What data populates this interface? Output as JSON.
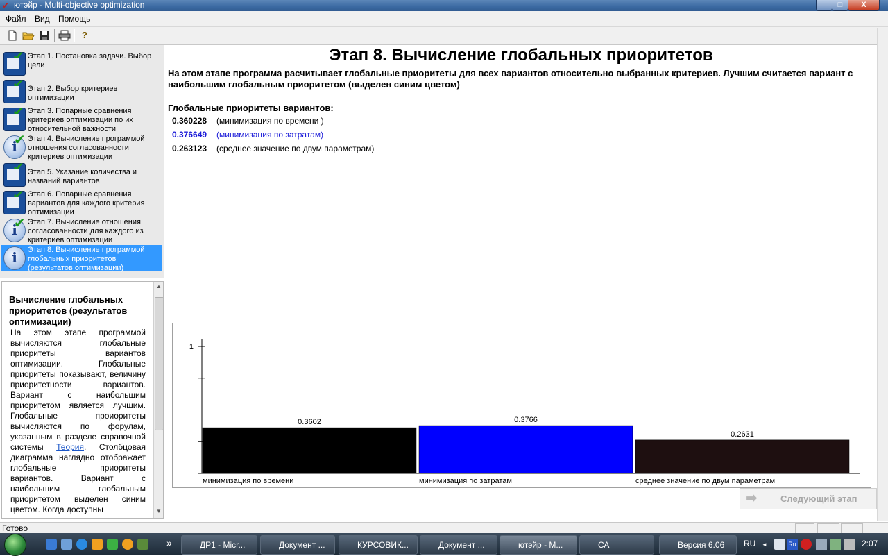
{
  "window": {
    "title": "ютэйр - Multi-objective optimization",
    "controls": {
      "minimize": "_",
      "maximize": "□",
      "close": "X"
    }
  },
  "menu": [
    "Файл",
    "Вид",
    "Помощь"
  ],
  "toolbar": {
    "icons": [
      "new-file-icon",
      "open-folder-icon",
      "save-icon",
      "print-icon",
      "help-icon"
    ],
    "help_glyph": "?"
  },
  "steps": [
    {
      "label": "Этап 1. Постановка задачи. Выбор цели",
      "icon": "check-pad-icon",
      "active": false
    },
    {
      "label": "Этап 2. Выбор критериев оптимизации",
      "icon": "check-pad-icon",
      "active": false
    },
    {
      "label": "Этап 3. Попарные сравнения критериев оптимизации по их относительной важности",
      "icon": "check-pad-icon",
      "active": false
    },
    {
      "label": "Этап 4. Вычисление программой отношения согласованности критериев оптимизации",
      "icon": "info-icon",
      "active": false
    },
    {
      "label": "Этап 5. Указание количества и названий вариантов",
      "icon": "check-pad-icon",
      "active": false
    },
    {
      "label": "Этап 6. Попарные сравнения вариантов для каждого критерия оптимизации",
      "icon": "check-pad-icon",
      "active": false
    },
    {
      "label": "Этап 7. Вычисление отношения согласованности для каждого из критериев оптимизации",
      "icon": "info-icon",
      "active": false
    },
    {
      "label": "Этап 8. Вычисление программой глобальных приоритетов (результатов оптимизации)",
      "icon": "info-icon",
      "active": true
    }
  ],
  "help": {
    "title": "Вычисление глобальных приоритетов (результатов оптимизации)",
    "body_part1": "На этом этапе программой вычисляются глобальные приоритеты вариантов оптимизации. Глобальные приоритеты показывают, величину приоритетности вариантов. Вариант с наибольшим приоритетом является лучшим. Глобальные проиоритеты вычисляются по форулам, указанным в разделе справочной системы ",
    "link": "Теория",
    "body_part2": ". Столбцовая диаграмма наглядно отображает глобальные приоритеты вариантов. Вариант с наибольшим глобальным приоритетом выделен синим цветом. Когда доступны"
  },
  "main": {
    "heading": "Этап 8. Вычисление глобальных приоритетов",
    "description": "На этом этапе программа расчитывает глобальные приоритеты для всех вариантов относительно выбранных критериев. Лучшим считается вариант с наибольшим глобальным приоритетом (выделен синим цветом)",
    "priorities_heading": "Глобальные приоритеты вариантов:",
    "priorities": [
      {
        "value": "0.360228",
        "name": "(минимизация по времени )",
        "best": false
      },
      {
        "value": "0.376649",
        "name": "(минимизация по затратам)",
        "best": true
      },
      {
        "value": "0.263123",
        "name": "(среднее значение по двум параметрам)",
        "best": false
      }
    ],
    "next_button": "Следующий этап"
  },
  "chart_data": {
    "type": "bar",
    "categories": [
      "минимизация по времени",
      "минимизация по затратам",
      "среднее значение по двум параметрам"
    ],
    "values": [
      0.3602,
      0.3766,
      0.2631
    ],
    "data_labels": [
      "0.3602",
      "0.3766",
      "0.2631"
    ],
    "colors": [
      "#000000",
      "#0000ff",
      "#1e0f10"
    ],
    "ylim": [
      0,
      1
    ],
    "yticks": [
      {
        "value": 1,
        "label": "1"
      }
    ],
    "ytick_count": 5,
    "title": "",
    "xlabel": "",
    "ylabel": "",
    "grid": false,
    "legend": "none"
  },
  "statusbar": {
    "text": "Готово"
  },
  "taskbar": {
    "tasks": [
      {
        "label": "ДР1 - Micr...",
        "color": "#2b5eb8"
      },
      {
        "label": "Документ ...",
        "color": "#2b5eb8"
      },
      {
        "label": "КУРСОВИК...",
        "color": "#2b5eb8"
      },
      {
        "label": "Документ ...",
        "color": "#2b5eb8"
      },
      {
        "label": "ютэйр - M...",
        "color": "#c02020"
      },
      {
        "label": "СА",
        "color": "#e8c040"
      },
      {
        "label": "Версия 6.06",
        "color": "#e8c040"
      }
    ],
    "lang": "RU",
    "lang_icon_text": "Ru",
    "clock": "2:07"
  }
}
